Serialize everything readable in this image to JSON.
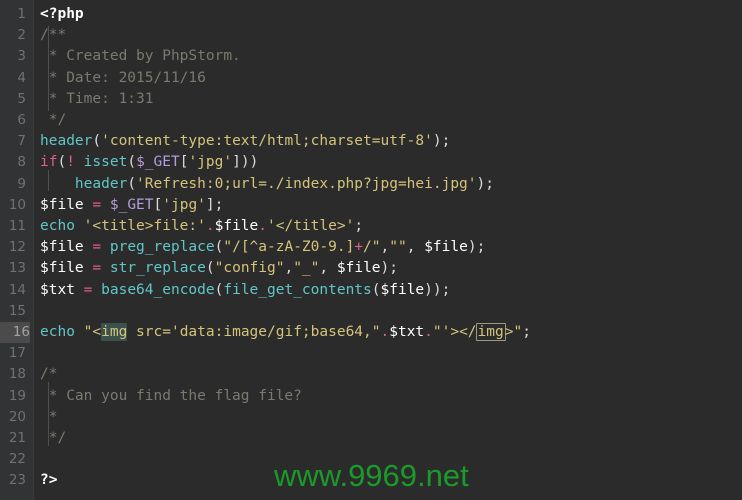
{
  "editor": {
    "theme_name": "darcula",
    "background_color": "#2b2b2b",
    "gutter_color": "#313335",
    "current_line": 16,
    "total_lines": 23
  },
  "watermark": {
    "text": "www.9969.net",
    "color": "#1a9a2b"
  },
  "lines": [
    {
      "n": "1",
      "text": "<?php"
    },
    {
      "n": "2",
      "text": "/**"
    },
    {
      "n": "3",
      "text": " * Created by PhpStorm."
    },
    {
      "n": "4",
      "text": " * Date: 2015/11/16"
    },
    {
      "n": "5",
      "text": " * Time: 1:31"
    },
    {
      "n": "6",
      "text": " */"
    },
    {
      "n": "7",
      "text": "header('content-type:text/html;charset=utf-8');"
    },
    {
      "n": "8",
      "text": "if(! isset($_GET['jpg']))"
    },
    {
      "n": "9",
      "text": "    header('Refresh:0;url=./index.php?jpg=hei.jpg');"
    },
    {
      "n": "10",
      "text": "$file = $_GET['jpg'];"
    },
    {
      "n": "11",
      "text": "echo '<title>file:'.$file.'</title>';"
    },
    {
      "n": "12",
      "text": "$file = preg_replace(\"/[^a-zA-Z0-9.]+/\",\"\", $file);"
    },
    {
      "n": "13",
      "text": "$file = str_replace(\"config\",\"_\", $file);"
    },
    {
      "n": "14",
      "text": "$txt = base64_encode(file_get_contents($file));"
    },
    {
      "n": "15",
      "text": ""
    },
    {
      "n": "16",
      "text": "echo \"<img src='data:image/gif;base64,\".$txt.\"'></img>\";"
    },
    {
      "n": "17",
      "text": ""
    },
    {
      "n": "18",
      "text": "/*"
    },
    {
      "n": "19",
      "text": " * Can you find the flag file?"
    },
    {
      "n": "20",
      "text": " *"
    },
    {
      "n": "21",
      "text": " */"
    },
    {
      "n": "22",
      "text": ""
    },
    {
      "n": "23",
      "text": "?>"
    }
  ],
  "tokens": {
    "l1": [
      {
        "c": "t-php",
        "s": "<?php"
      }
    ],
    "l2": [
      {
        "c": "t-com",
        "s": "/**"
      }
    ],
    "l3": [
      {
        "c": "t-com",
        "s": " * Created by PhpStorm."
      }
    ],
    "l4": [
      {
        "c": "t-com",
        "s": " * Date: 2015/11/16"
      }
    ],
    "l5": [
      {
        "c": "t-com",
        "s": " * Time: 1:31"
      }
    ],
    "l6": [
      {
        "c": "t-com",
        "s": " */"
      }
    ],
    "l7": [
      {
        "c": "t-fn",
        "s": "header"
      },
      {
        "c": "t-punct",
        "s": "("
      },
      {
        "c": "t-str",
        "s": "'content-type:text/html;charset=utf-8'"
      },
      {
        "c": "t-punct",
        "s": ");"
      }
    ],
    "l8": [
      {
        "c": "t-ctrl",
        "s": "if"
      },
      {
        "c": "t-punct",
        "s": "("
      },
      {
        "c": "t-op",
        "s": "!"
      },
      {
        "c": "t-punct",
        "s": " "
      },
      {
        "c": "t-fn",
        "s": "isset"
      },
      {
        "c": "t-punct",
        "s": "("
      },
      {
        "c": "t-gvar",
        "s": "$_GET"
      },
      {
        "c": "t-punct",
        "s": "["
      },
      {
        "c": "t-str",
        "s": "'jpg'"
      },
      {
        "c": "t-punct",
        "s": "]))"
      }
    ],
    "l9": [
      {
        "c": "t-plain",
        "s": "    "
      },
      {
        "c": "t-fn",
        "s": "header"
      },
      {
        "c": "t-punct",
        "s": "("
      },
      {
        "c": "t-str",
        "s": "'Refresh:0;url=./index.php?jpg=hei.jpg'"
      },
      {
        "c": "t-punct",
        "s": ");"
      }
    ],
    "l10": [
      {
        "c": "t-var",
        "s": "$file"
      },
      {
        "c": "t-punct",
        "s": " "
      },
      {
        "c": "t-op",
        "s": "="
      },
      {
        "c": "t-punct",
        "s": " "
      },
      {
        "c": "t-gvar",
        "s": "$_GET"
      },
      {
        "c": "t-punct",
        "s": "["
      },
      {
        "c": "t-str",
        "s": "'jpg'"
      },
      {
        "c": "t-punct",
        "s": "];"
      }
    ],
    "l11": [
      {
        "c": "t-fn",
        "s": "echo"
      },
      {
        "c": "t-punct",
        "s": " "
      },
      {
        "c": "t-str",
        "s": "'<title>file:'"
      },
      {
        "c": "t-op",
        "s": "."
      },
      {
        "c": "t-var",
        "s": "$file"
      },
      {
        "c": "t-op",
        "s": "."
      },
      {
        "c": "t-str",
        "s": "'</title>'"
      },
      {
        "c": "t-punct",
        "s": ";"
      }
    ],
    "l12": [
      {
        "c": "t-var",
        "s": "$file"
      },
      {
        "c": "t-punct",
        "s": " "
      },
      {
        "c": "t-op",
        "s": "="
      },
      {
        "c": "t-punct",
        "s": " "
      },
      {
        "c": "t-fn",
        "s": "preg_replace"
      },
      {
        "c": "t-punct",
        "s": "("
      },
      {
        "c": "t-str",
        "s": "\"/[^a-zA-Z0-9.]"
      },
      {
        "c": "t-op",
        "s": "+"
      },
      {
        "c": "t-str",
        "s": "/\""
      },
      {
        "c": "t-punct",
        "s": ","
      },
      {
        "c": "t-str",
        "s": "\"\""
      },
      {
        "c": "t-punct",
        "s": ", "
      },
      {
        "c": "t-var",
        "s": "$file"
      },
      {
        "c": "t-punct",
        "s": ");"
      }
    ],
    "l13": [
      {
        "c": "t-var",
        "s": "$file"
      },
      {
        "c": "t-punct",
        "s": " "
      },
      {
        "c": "t-op",
        "s": "="
      },
      {
        "c": "t-punct",
        "s": " "
      },
      {
        "c": "t-fn",
        "s": "str_replace"
      },
      {
        "c": "t-punct",
        "s": "("
      },
      {
        "c": "t-str",
        "s": "\"config\""
      },
      {
        "c": "t-punct",
        "s": ","
      },
      {
        "c": "t-str",
        "s": "\"_\""
      },
      {
        "c": "t-punct",
        "s": ", "
      },
      {
        "c": "t-var",
        "s": "$file"
      },
      {
        "c": "t-punct",
        "s": ");"
      }
    ],
    "l14": [
      {
        "c": "t-var",
        "s": "$txt"
      },
      {
        "c": "t-punct",
        "s": " "
      },
      {
        "c": "t-op",
        "s": "="
      },
      {
        "c": "t-punct",
        "s": " "
      },
      {
        "c": "t-fn",
        "s": "base64_encode"
      },
      {
        "c": "t-punct",
        "s": "("
      },
      {
        "c": "t-fn",
        "s": "file_get_contents"
      },
      {
        "c": "t-punct",
        "s": "("
      },
      {
        "c": "t-var",
        "s": "$file"
      },
      {
        "c": "t-punct",
        "s": "));"
      }
    ],
    "l15": [],
    "l16": [
      {
        "c": "t-fn",
        "s": "echo"
      },
      {
        "c": "t-punct",
        "s": " "
      },
      {
        "c": "t-str",
        "s": "\"<"
      },
      {
        "c": "tag-hl",
        "s": "img"
      },
      {
        "c": "t-str",
        "s": " src='data:image/gif;base64,\""
      },
      {
        "c": "t-op",
        "s": "."
      },
      {
        "c": "t-var",
        "s": "$txt"
      },
      {
        "c": "t-op",
        "s": "."
      },
      {
        "c": "t-str",
        "s": "\"'></"
      },
      {
        "c": "tag-box",
        "s": "img"
      },
      {
        "c": "t-str",
        "s": ">\""
      },
      {
        "c": "t-punct",
        "s": ";"
      }
    ],
    "l17": [],
    "l18": [
      {
        "c": "t-com",
        "s": "/*"
      }
    ],
    "l19": [
      {
        "c": "t-com",
        "s": " * Can you find the flag file?"
      }
    ],
    "l20": [
      {
        "c": "t-com",
        "s": " *"
      }
    ],
    "l21": [
      {
        "c": "t-com",
        "s": " */"
      }
    ],
    "l22": [],
    "l23": [
      {
        "c": "t-php",
        "s": "?>"
      }
    ]
  }
}
